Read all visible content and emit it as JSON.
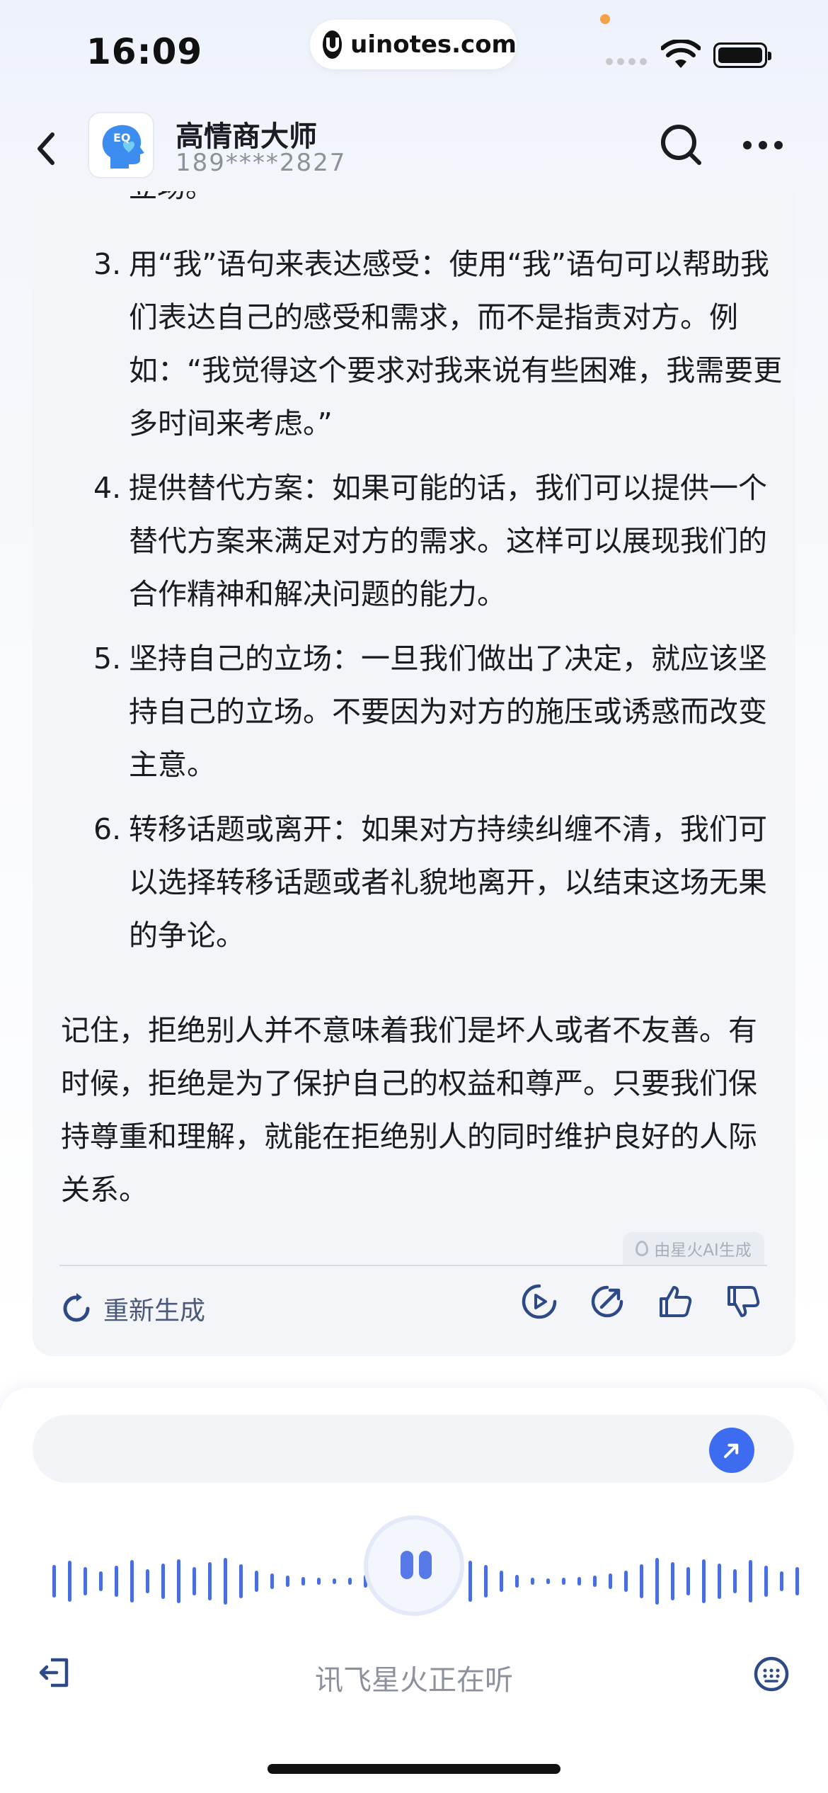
{
  "status_bar": {
    "time": "16:09",
    "url": "uinotes.com"
  },
  "header": {
    "bot_name": "高情商大师",
    "phone": "189****2827",
    "avatar_label": "EQ",
    "accent": "#3d6cf0"
  },
  "message": {
    "clipped_text": "立场。",
    "list": [
      {
        "num": "3.",
        "text": "用“我”语句来表达感受：使用“我”语句可以帮助我们表达自己的感受和需求，而不是指责对方。例如：“我觉得这个要求对我来说有些困难，我需要更多时间来考虑。”"
      },
      {
        "num": "4.",
        "text": "提供替代方案：如果可能的话，我们可以提供一个替代方案来满足对方的需求。这样可以展现我们的合作精神和解决问题的能力。"
      },
      {
        "num": "5.",
        "text": "坚持自己的立场：一旦我们做出了决定，就应该坚持自己的立场。不要因为对方的施压或诱惑而改变主意。"
      },
      {
        "num": "6.",
        "text": "转移话题或离开：如果对方持续纠缠不清，我们可以选择转移话题或者礼貌地离开，以结束这场无果的争论。"
      }
    ],
    "closing": "记住，拒绝别人并不意味着我们是坏人或者不友善。有时候，拒绝是为了保护自己的权益和尊严。只要我们保持尊重和理解，就能在拒绝别人的同时维护良好的人际关系。",
    "ai_tag": "由星火AI生成",
    "regenerate_label": "重新生成",
    "actions": [
      "play-icon",
      "share-icon",
      "thumbs-up-icon",
      "thumbs-down-icon"
    ]
  },
  "input": {
    "placeholder": "",
    "listening_text": "讯飞星火正在听"
  }
}
